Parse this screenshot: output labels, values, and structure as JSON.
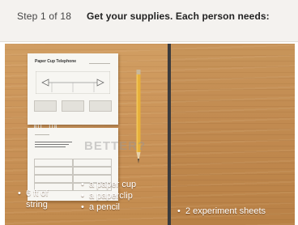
{
  "header": {
    "step_label": "Step 1 of 18",
    "title": "Get your supplies. Each person needs:"
  },
  "supplies": {
    "string_line1": "6 ft of",
    "string_line2": "string",
    "cup": "a paper cup",
    "paperclip": "a paperclip",
    "pencil": "a pencil",
    "sheets": "2 experiment sheets",
    "bullet": "•"
  },
  "sheet_top": {
    "title": "Paper Cup Telephone"
  },
  "sheet_bottom": {
    "big_word": "BETTER?"
  },
  "colors": {
    "wood": "#c78f54",
    "divider": "#3b3b3d",
    "header_bg": "#f4f2ef"
  }
}
